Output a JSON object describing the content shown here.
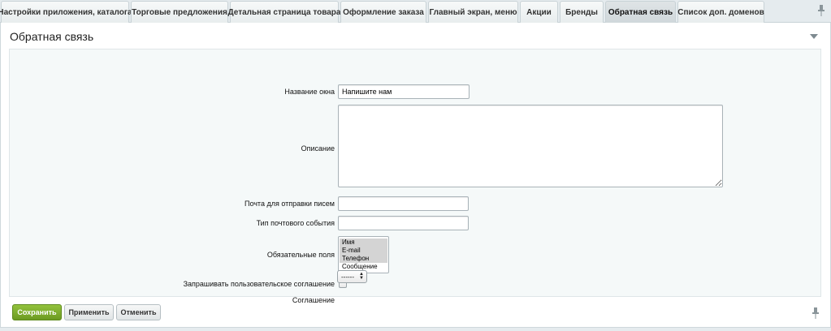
{
  "tabs": [
    {
      "label": "Настройки приложения, каталога"
    },
    {
      "label": "Торговые предложения"
    },
    {
      "label": "Детальная страница товара"
    },
    {
      "label": "Оформление заказа"
    },
    {
      "label": "Главный экран, меню"
    },
    {
      "label": "Акции"
    },
    {
      "label": "Бренды"
    },
    {
      "label": "Обратная связь"
    },
    {
      "label": "Список доп. доменов"
    }
  ],
  "active_tab": "Обратная связь",
  "panel": {
    "title": "Обратная связь"
  },
  "form": {
    "window_name_label": "Название окна",
    "window_name_value": "Напишите нам",
    "description_label": "Описание",
    "description_value": "",
    "mail_label": "Почта для отправки писем",
    "mail_value": "",
    "event_type_label": "Тип почтового события",
    "event_type_value": "",
    "required_fields_label": "Обязательные поля",
    "required_fields_options": [
      {
        "label": "Имя",
        "selected": true
      },
      {
        "label": "E-mail",
        "selected": true
      },
      {
        "label": "Телефон",
        "selected": true
      },
      {
        "label": "Сообщение",
        "selected": false
      }
    ],
    "agreement_request_label": "Запрашивать пользовательское соглашение",
    "agreement_request_checked": false,
    "agreement_label": "Соглашение",
    "agreement_value": "------"
  },
  "footer": {
    "save_label": "Сохранить",
    "apply_label": "Применить",
    "cancel_label": "Отменить"
  }
}
